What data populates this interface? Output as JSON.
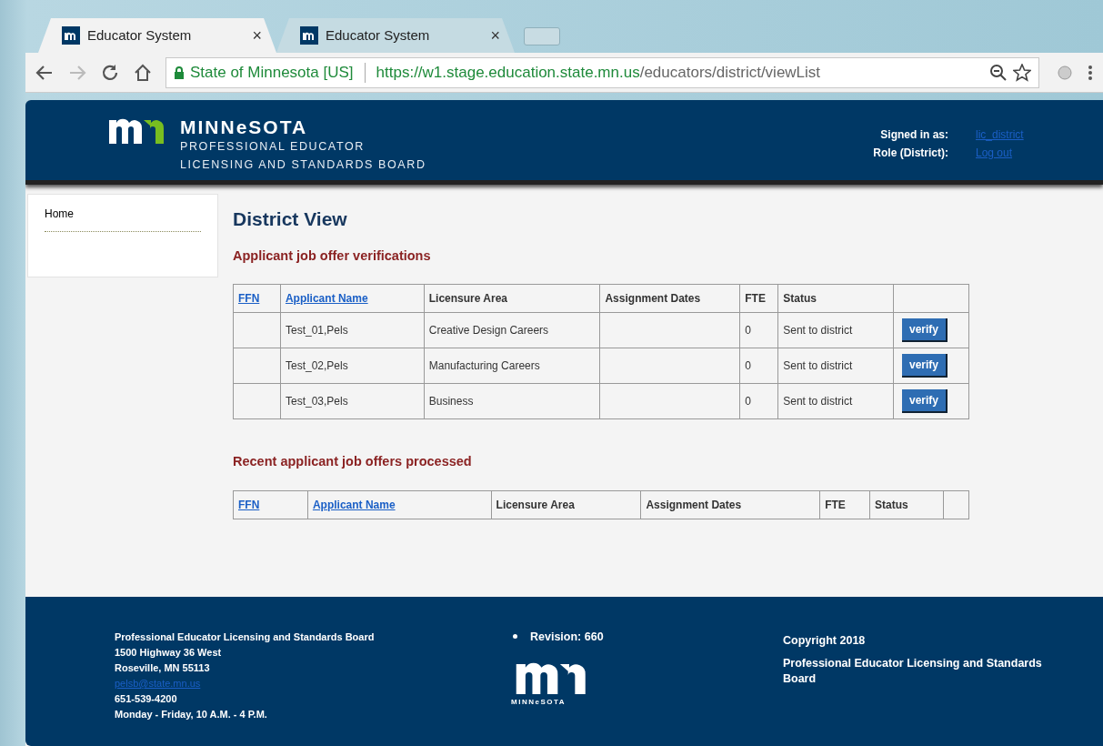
{
  "browser": {
    "tabs": [
      {
        "title": "Educator System",
        "close": "×",
        "selected": true
      },
      {
        "title": "Educator System",
        "close": "×",
        "selected": false
      }
    ],
    "address": {
      "identity": "State of Minnesota [US]",
      "url_scheme": "https://",
      "url_host": "w1.stage.education.state.mn.us",
      "url_path": "/educators/district/viewList"
    }
  },
  "header": {
    "brand": "MINNeSOTA",
    "subtitle_1": "PROFESSIONAL EDUCATOR",
    "subtitle_2": "LICENSING AND STANDARDS BOARD",
    "signed_in_label": "Signed in as:",
    "signed_in_user": "lic_district",
    "role_label": "Role (District):",
    "logout": "Log out"
  },
  "sidebar": {
    "items": [
      {
        "label": "Home"
      }
    ]
  },
  "page_title": "District View",
  "sections": [
    {
      "heading": "Applicant job offer verifications",
      "columns": [
        {
          "label": "FFN",
          "link": true
        },
        {
          "label": "Applicant Name",
          "link": true
        },
        {
          "label": "Licensure Area",
          "link": false
        },
        {
          "label": "Assignment Dates",
          "link": false
        },
        {
          "label": "FTE",
          "link": false
        },
        {
          "label": "Status",
          "link": false
        }
      ],
      "action_column": true,
      "rows": [
        {
          "name": "Test_01,Pels",
          "area": "Creative Design Careers",
          "fte": "0",
          "status": "Sent to district",
          "action": "verify"
        },
        {
          "name": "Test_02,Pels",
          "area": "Manufacturing Careers",
          "fte": "0",
          "status": "Sent to district",
          "action": "verify"
        },
        {
          "name": "Test_03,Pels",
          "area": "Business",
          "fte": "0",
          "status": "Sent to district",
          "action": "verify"
        }
      ]
    },
    {
      "heading": "Recent applicant job offers processed",
      "columns": [
        {
          "label": "FFN",
          "link": true
        },
        {
          "label": "Applicant Name",
          "link": true
        },
        {
          "label": "Licensure Area",
          "link": false
        },
        {
          "label": "Assignment Dates",
          "link": false
        },
        {
          "label": "FTE",
          "link": false
        },
        {
          "label": "Status",
          "link": false
        }
      ],
      "action_column": true
    }
  ],
  "footer": {
    "address_lines": [
      {
        "text": "Professional Educator Licensing and Standards Board",
        "kind": "text"
      },
      {
        "text": "1500 Highway 36 West",
        "kind": "text"
      },
      {
        "text": "Roseville, MN 55113",
        "kind": "text"
      },
      {
        "text": "pelsb@state.mn.us",
        "kind": "link"
      },
      {
        "text": "651-539-4200",
        "kind": "text"
      },
      {
        "text": "Monday - Friday, 10 A.M. - 4 P.M.",
        "kind": "text"
      }
    ],
    "revision": "Revision: 660",
    "logo_caption": "MINNeSOTA",
    "copyright": "Copyright 2018",
    "board": "Professional Educator Licensing and Standards Board"
  }
}
